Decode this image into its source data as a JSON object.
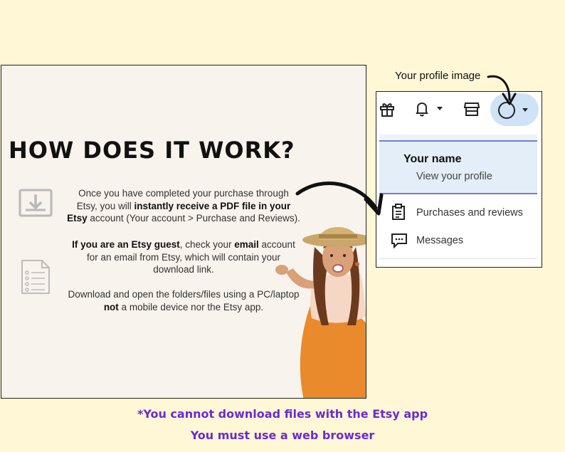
{
  "panel": {
    "headline": "HOW DOES IT WORK?",
    "step1": {
      "a": "Once you have completed your purchase through Etsy, you will ",
      "b": "instantly receive a PDF file in your Etsy",
      "c": " account (Your account > Purchase and Reviews)."
    },
    "step2": {
      "a": "If you are an Etsy guest",
      "b": ", check your ",
      "c": "email",
      "d": " account for an email from Etsy, which will contain your download link."
    },
    "step3": {
      "a": "Download and open the folders/files using a PC/laptop ",
      "b": "not",
      "c": " a mobile device nor the Etsy app."
    },
    "icons": [
      "download-icon",
      "document-list-icon"
    ]
  },
  "etsy_menu": {
    "annotation": "Your profile image",
    "top_icons": [
      "gift-icon",
      "bell-icon",
      "shop-icon",
      "avatar-icon"
    ],
    "your_name": "Your name",
    "view_profile": "View your profile",
    "items": [
      {
        "label": "Purchases and reviews",
        "icon": "clipboard-icon"
      },
      {
        "label": "Messages",
        "icon": "message-icon"
      }
    ]
  },
  "footer": {
    "line1": "*You cannot download files with the Etsy app",
    "line2": "You must use a web browser"
  },
  "colors": {
    "background": "#fff7d6",
    "panel": "#f8f3ec",
    "footer_text": "#6a2bd4",
    "avatar_highlight": "#cfe3f6",
    "accent_line": "#6c7fd8"
  }
}
